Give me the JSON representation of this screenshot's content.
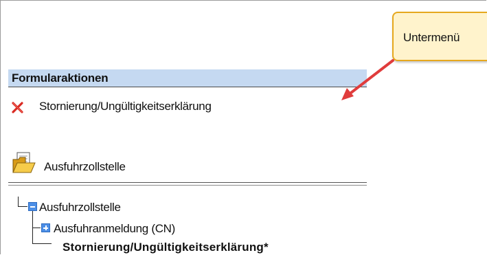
{
  "form_actions": {
    "header": "Formularaktionen",
    "items": [
      {
        "label": "Stornierung/Ungültigkeitserklärung",
        "icon": "red-x-icon"
      }
    ]
  },
  "office": {
    "label": "Ausfuhrzollstelle",
    "icon": "open-folder-icon"
  },
  "tree": {
    "root": {
      "label": "Ausfuhrzollstelle",
      "icon": "collapse-icon"
    },
    "child": {
      "label": "Ausfuhranmeldung (CN)",
      "icon": "expand-icon"
    },
    "leaf": {
      "label": "Stornierung/Ungültigkeitserklärung*"
    }
  },
  "callout": {
    "text": "Untermenü",
    "fill_color": "#fff3cc",
    "border_color": "#e6a81e",
    "arrow_color": "#e03c3c"
  },
  "colors": {
    "header_bg": "#c5d9f1",
    "tree_icon": "#4b8ee6"
  }
}
